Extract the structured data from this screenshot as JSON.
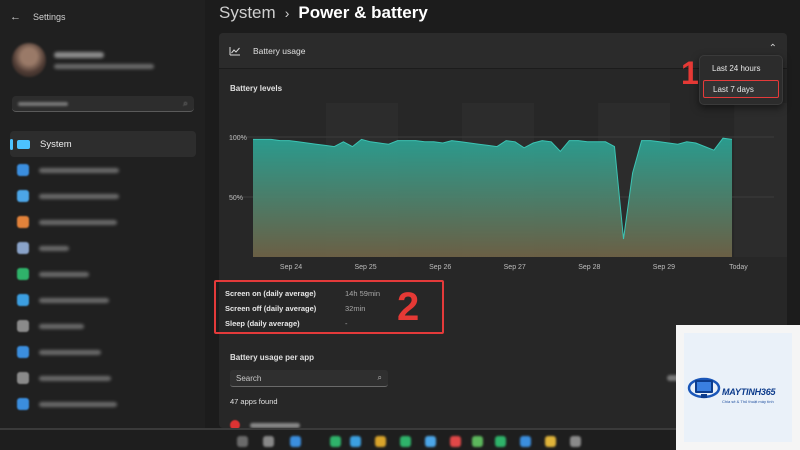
{
  "window": {
    "title": "Settings",
    "back_glyph": "←"
  },
  "sidebar": {
    "items": [
      {
        "label": "System",
        "active": true,
        "icon": "monitor-icon",
        "color": "#4cc2ff"
      },
      {
        "label": "",
        "icon": "bluetooth-icon",
        "color": "#3b8ede"
      },
      {
        "label": "",
        "icon": "wifi-icon",
        "color": "#4ca6e8"
      },
      {
        "label": "",
        "icon": "brush-icon",
        "color": "#e2823a"
      },
      {
        "label": "",
        "icon": "apps-icon",
        "color": "#8aa3c9"
      },
      {
        "label": "",
        "icon": "user-icon",
        "color": "#2fb36a"
      },
      {
        "label": "",
        "icon": "globe-icon",
        "color": "#3c9ee0"
      },
      {
        "label": "",
        "icon": "gamepad-icon",
        "color": "#8a8a8a"
      },
      {
        "label": "",
        "icon": "accessibility-icon",
        "color": "#3b8ede"
      },
      {
        "label": "",
        "icon": "shield-icon",
        "color": "#8a8a8a"
      },
      {
        "label": "",
        "icon": "update-icon",
        "color": "#3b8ede"
      }
    ]
  },
  "header": {
    "crumb": "System",
    "separator": "›",
    "current": "Power & battery"
  },
  "battery_card": {
    "title": "Battery usage",
    "levels_label": "Battery levels",
    "collapse_glyph": "⌃",
    "range_options": [
      "Last 24 hours",
      "Last 7 days"
    ],
    "selected_range": "Last 7 days",
    "annotation_1": "1",
    "annotation_2": "2"
  },
  "chart_data": {
    "type": "area",
    "x": [
      "Sep 24",
      "Sep 25",
      "Sep 26",
      "Sep 27",
      "Sep 28",
      "Sep 29",
      "Today"
    ],
    "y_ticks": [
      "100%",
      "50%"
    ],
    "ylim": [
      0,
      100
    ],
    "series": [
      {
        "values": [
          98,
          98,
          98,
          97,
          97,
          96,
          95,
          94,
          93,
          92,
          96,
          92,
          98,
          96,
          95,
          94,
          97,
          97,
          97,
          96,
          96,
          95,
          97,
          96,
          95,
          94,
          93,
          92,
          97,
          96,
          91,
          95,
          97,
          96,
          88,
          97,
          97,
          96,
          96,
          96,
          92,
          15,
          70,
          97,
          97,
          96,
          95,
          94,
          96,
          95,
          92,
          89,
          99,
          98
        ]
      }
    ],
    "grid": true,
    "colors": {
      "fill_top": "#2aa193",
      "fill_bottom": "#6e6246",
      "line": "#3cc4b4"
    }
  },
  "stats": [
    {
      "label": "Screen on (daily average)",
      "value": "14h 59min"
    },
    {
      "label": "Screen off (daily average)",
      "value": "32min"
    },
    {
      "label": "Sleep (daily average)",
      "value": "-"
    }
  ],
  "per_app": {
    "title": "Battery usage per app",
    "search_placeholder": "Search",
    "search_glyph": "⌕",
    "count_text": "47 apps found"
  },
  "watermark": {
    "brand": "MAYTINH365",
    "tagline": "Chia sẻ & Thủ thuật máy tính"
  }
}
